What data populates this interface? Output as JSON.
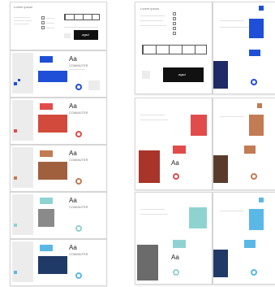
{
  "brand": {
    "typeface_sample": "Aa",
    "typeface_name": "COMMUTER",
    "logo_text": ".agsd"
  },
  "colors": {
    "blue": "#1f4fd6",
    "red": "#e24b4b",
    "orange_brown": "#c27b53",
    "teal": "#8fd3d1",
    "sky": "#5ab8e6",
    "dark": "#141414"
  },
  "labels": {
    "tiny": "Lorem ipsum"
  }
}
